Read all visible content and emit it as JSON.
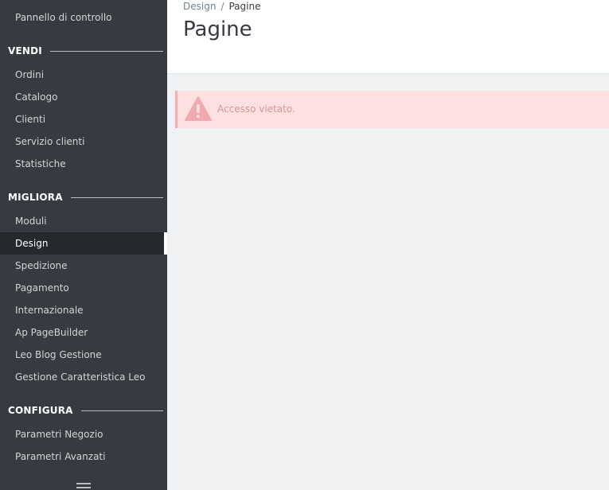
{
  "sidebar": {
    "top_item": "Pannello di controllo",
    "sections": [
      {
        "title": "VENDI",
        "items": [
          "Ordini",
          "Catalogo",
          "Clienti",
          "Servizio clienti",
          "Statistiche"
        ]
      },
      {
        "title": "MIGLIORA",
        "items": [
          "Moduli",
          "Design",
          "Spedizione",
          "Pagamento",
          "Internazionale",
          "Ap PageBuilder",
          "Leo Blog Gestione",
          "Gestione Caratteristica Leo"
        ]
      },
      {
        "title": "CONFIGURA",
        "items": [
          "Parametri Negozio",
          "Parametri Avanzati"
        ]
      }
    ],
    "active_item": "Design",
    "menu_toggle_icon": "hamburger-icon"
  },
  "header": {
    "breadcrumb": {
      "parent": "Design",
      "separator": "/",
      "current": "Pagine"
    },
    "title": "Pagine"
  },
  "alert": {
    "icon": "warning-icon",
    "message": "Accesso vietato."
  },
  "colors": {
    "sidebar_bg": "#363a41",
    "sidebar_active_bg": "#25282c",
    "alert_bg": "#fde1e1",
    "alert_text": "#d5969d"
  }
}
